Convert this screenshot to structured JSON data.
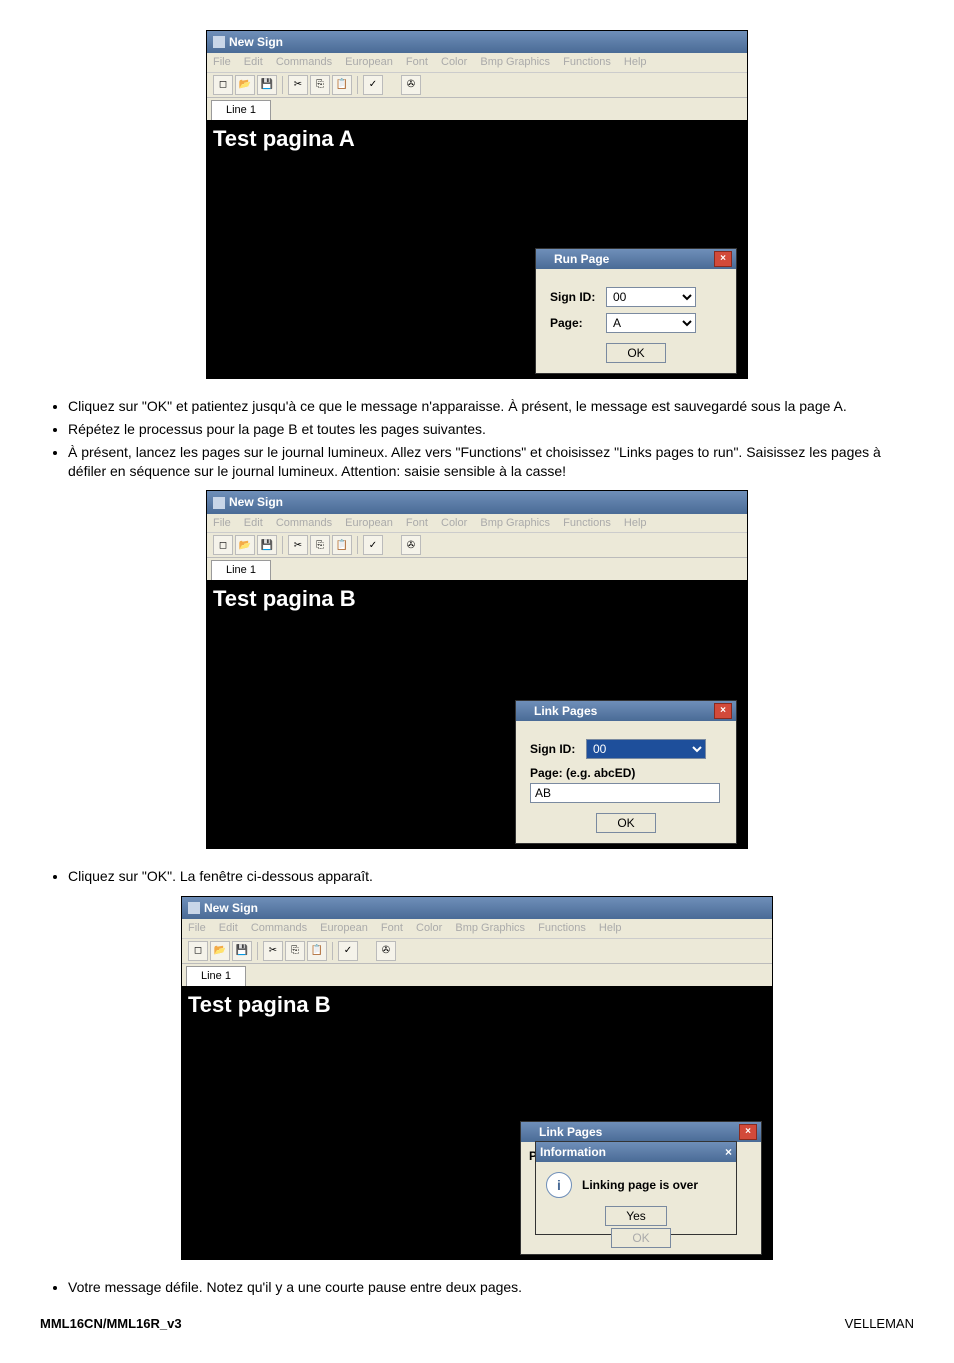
{
  "app": {
    "title": "New Sign",
    "menu": [
      "File",
      "Edit",
      "Commands",
      "European",
      "Font",
      "Color",
      "Bmp Graphics",
      "Functions",
      "Help"
    ],
    "tab": "Line 1",
    "toolbar_icons": [
      {
        "name": "new-icon",
        "glyph": "◻"
      },
      {
        "name": "open-icon",
        "glyph": "📂"
      },
      {
        "name": "save-icon",
        "glyph": "💾"
      },
      {
        "name": "cut-icon",
        "glyph": "✂"
      },
      {
        "name": "copy-icon",
        "glyph": "⎘"
      },
      {
        "name": "paste-icon",
        "glyph": "📋"
      },
      {
        "name": "preview-icon",
        "glyph": "✓"
      },
      {
        "name": "send-icon",
        "glyph": "✇"
      }
    ]
  },
  "shot1": {
    "canvas_text": "Test pagina A",
    "dialog": {
      "title": "Run Page",
      "sign_id_label": "Sign ID:",
      "sign_id_value": "00",
      "page_label": "Page:",
      "page_value": "A",
      "ok": "OK"
    }
  },
  "bullets1": [
    "Cliquez sur \"OK\" et patientez jusqu'à ce que le message n'apparaisse. À présent, le message est sauvegardé sous la page A.",
    "Répétez le processus pour la page B et toutes les pages suivantes.",
    "À présent, lancez les pages sur le journal lumineux. Allez vers \"Functions\" et choisissez \"Links pages to run\". Saisissez les pages à défiler en séquence sur le journal lumineux. Attention: saisie sensible à la casse!"
  ],
  "shot2": {
    "canvas_text": "Test pagina B",
    "dialog": {
      "title": "Link Pages",
      "sign_id_label": "Sign ID:",
      "sign_id_value": "00",
      "page_label": "Page: (e.g. abcED)",
      "page_value": "AB",
      "ok": "OK"
    }
  },
  "bullets2": [
    "Cliquez sur \"OK\". La fenêtre ci-dessous apparaît."
  ],
  "shot3": {
    "canvas_text": "Test pagina B",
    "dialog": {
      "title": "Link Pages",
      "page_label_marker": "P",
      "ok": "OK"
    },
    "info": {
      "title": "Information",
      "msg": "Linking page is over",
      "yes": "Yes"
    }
  },
  "bullets3": [
    "Votre message défile. Notez qu'il y a une courte pause entre deux pages."
  ],
  "footer": {
    "left": "MML16CN/MML16R_v3",
    "right": "VELLEMAN"
  }
}
